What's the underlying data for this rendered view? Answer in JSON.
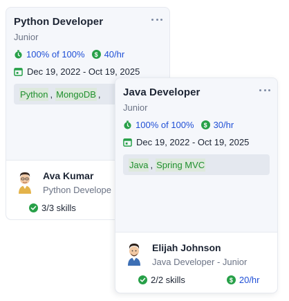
{
  "cards": [
    {
      "title": "Python Developer",
      "level": "Junior",
      "progress": "100% of 100%",
      "rate": "40/hr",
      "dates": "Dec 19, 2022 - Oct 19, 2025",
      "skills": [
        "Python",
        "MongoDB"
      ],
      "skill_sep": ",",
      "person": {
        "name": "Ava Kumar",
        "role": "Python Develope",
        "skills_count": "3/3 skills"
      }
    },
    {
      "title": "Java Developer",
      "level": "Junior",
      "progress": "100% of 100%",
      "rate": "30/hr",
      "dates": "Dec 19, 2022 - Oct 19, 2025",
      "skills": [
        "Java",
        "Spring MVC"
      ],
      "skill_sep": ",",
      "person": {
        "name": "Elijah Johnson",
        "role": "Java Developer - Junior",
        "skills_count": "2/2 skills",
        "rate": "20/hr"
      }
    }
  ],
  "icons": {
    "more": "more-horizontal-icon",
    "timer": "stopwatch-icon",
    "money": "dollar-circle-icon",
    "calendar": "calendar-icon",
    "check": "check-circle-icon",
    "avatar": "developer-avatar"
  },
  "colors": {
    "accent_blue": "#1f4fd6",
    "accent_green": "#1f8f2e",
    "card_bg": "#f5f7fb",
    "chip_bg": "#e4e8ef"
  }
}
